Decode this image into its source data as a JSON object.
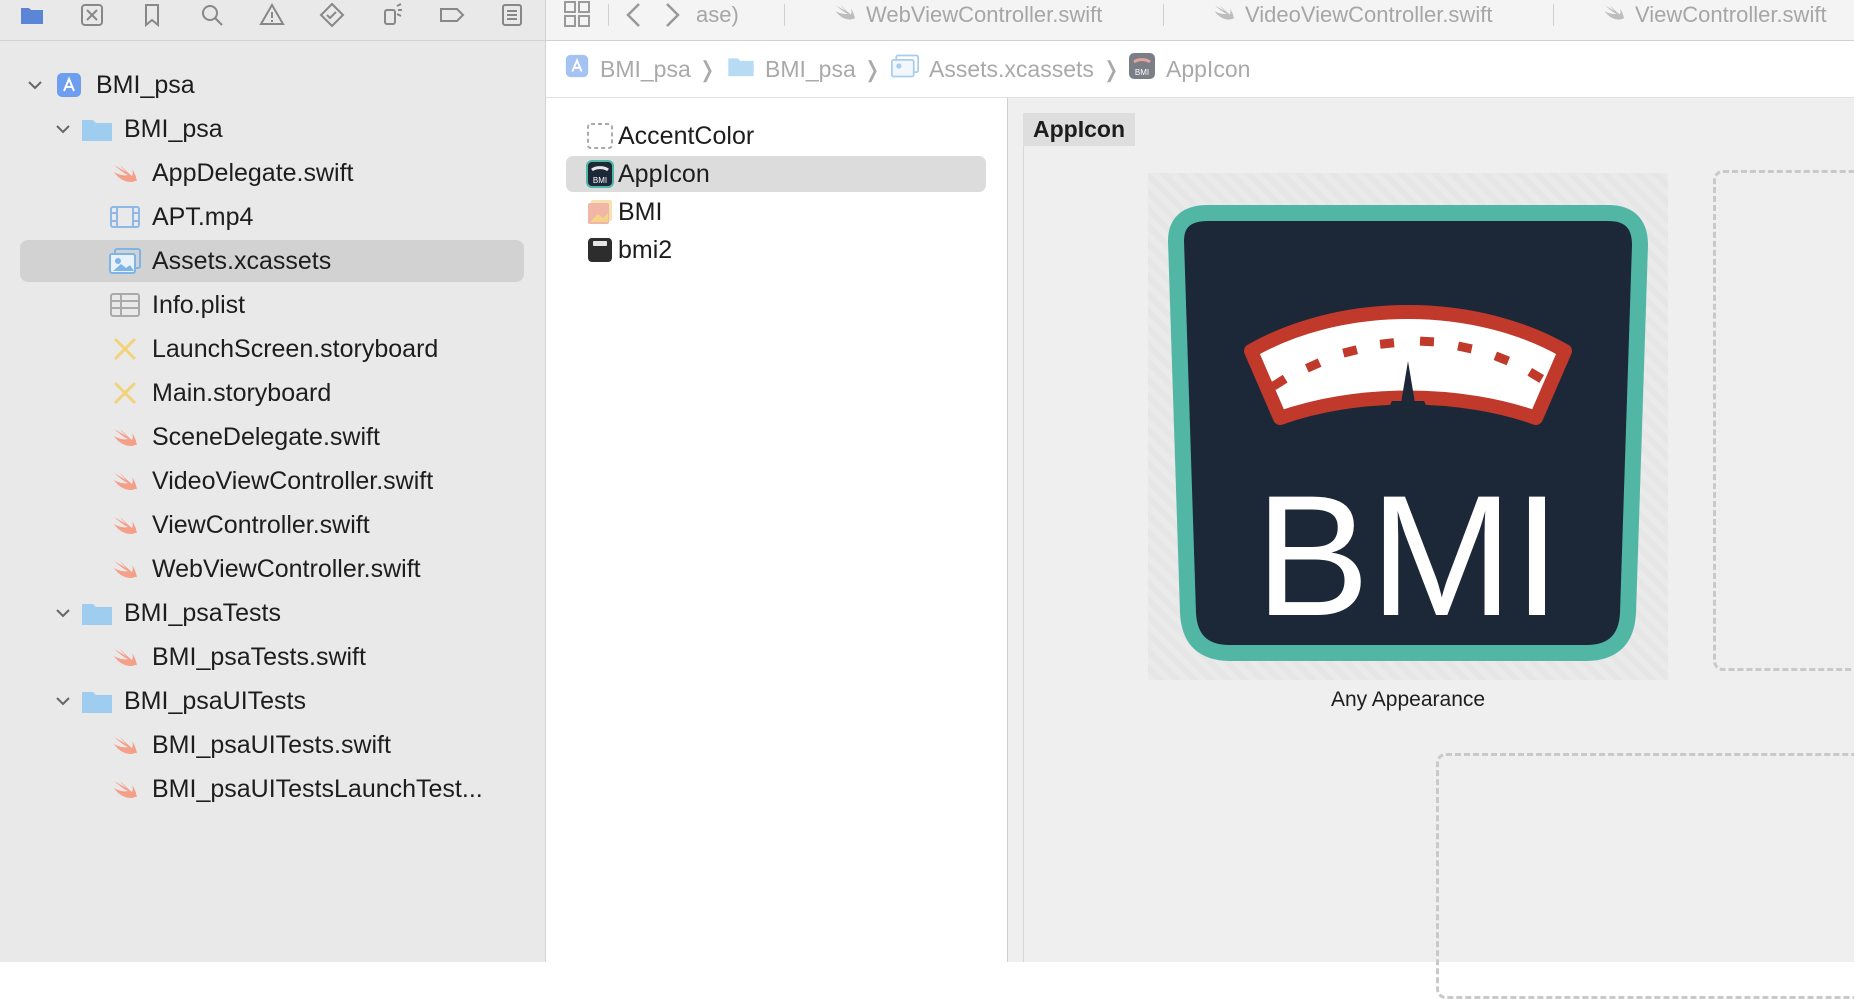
{
  "navigator": {
    "toolbar_icons": [
      "folder-icon",
      "source-control-icon",
      "bookmark-icon",
      "search-icon",
      "warning-icon",
      "test-icon",
      "debug-icon",
      "breakpoint-icon",
      "report-icon"
    ],
    "tree": [
      {
        "label": "BMI_psa",
        "icon": "project-icon",
        "level": 0,
        "expanded": true
      },
      {
        "label": "BMI_psa",
        "icon": "folder-icon",
        "level": 1,
        "expanded": true
      },
      {
        "label": "AppDelegate.swift",
        "icon": "swift-icon",
        "level": 2
      },
      {
        "label": "APT.mp4",
        "icon": "video-icon",
        "level": 2
      },
      {
        "label": "Assets.xcassets",
        "icon": "assets-icon",
        "level": 2,
        "selected": true
      },
      {
        "label": "Info.plist",
        "icon": "plist-icon",
        "level": 2
      },
      {
        "label": "LaunchScreen.storyboard",
        "icon": "storyboard-icon",
        "level": 2
      },
      {
        "label": "Main.storyboard",
        "icon": "storyboard-icon",
        "level": 2
      },
      {
        "label": "SceneDelegate.swift",
        "icon": "swift-icon",
        "level": 2
      },
      {
        "label": "VideoViewController.swift",
        "icon": "swift-icon",
        "level": 2
      },
      {
        "label": "ViewController.swift",
        "icon": "swift-icon",
        "level": 2
      },
      {
        "label": "WebViewController.swift",
        "icon": "swift-icon",
        "level": 2
      },
      {
        "label": "BMI_psaTests",
        "icon": "folder-icon",
        "level": 1,
        "expanded": true
      },
      {
        "label": "BMI_psaTests.swift",
        "icon": "swift-icon",
        "level": 2
      },
      {
        "label": "BMI_psaUITests",
        "icon": "folder-icon",
        "level": 1,
        "expanded": true
      },
      {
        "label": "BMI_psaUITests.swift",
        "icon": "swift-icon",
        "level": 2
      },
      {
        "label": "BMI_psaUITestsLaunchTest...",
        "icon": "swift-icon",
        "level": 2
      }
    ]
  },
  "tabbar": {
    "partial_tab": "ase)",
    "tabs": [
      "WebViewController.swift",
      "VideoViewController.swift",
      "ViewController.swift"
    ]
  },
  "jumpbar": {
    "crumbs": [
      "BMI_psa",
      "BMI_psa",
      "Assets.xcassets",
      "AppIcon"
    ]
  },
  "asset_list": {
    "items": [
      {
        "label": "AccentColor",
        "icon": "color-set-icon"
      },
      {
        "label": "AppIcon",
        "icon": "app-icon-set-icon",
        "selected": true
      },
      {
        "label": "BMI",
        "icon": "image-set-icon"
      },
      {
        "label": "bmi2",
        "icon": "image-set-icon-dark"
      }
    ]
  },
  "canvas": {
    "set_title": "AppIcon",
    "icon_text": "BMI",
    "caption": "Any Appearance"
  },
  "colors": {
    "accent": "#7a9fe0",
    "swift": "#f0907a",
    "icon_bg": "#1c2838",
    "icon_border": "#52b6a5",
    "gauge_red": "#c0392b"
  }
}
